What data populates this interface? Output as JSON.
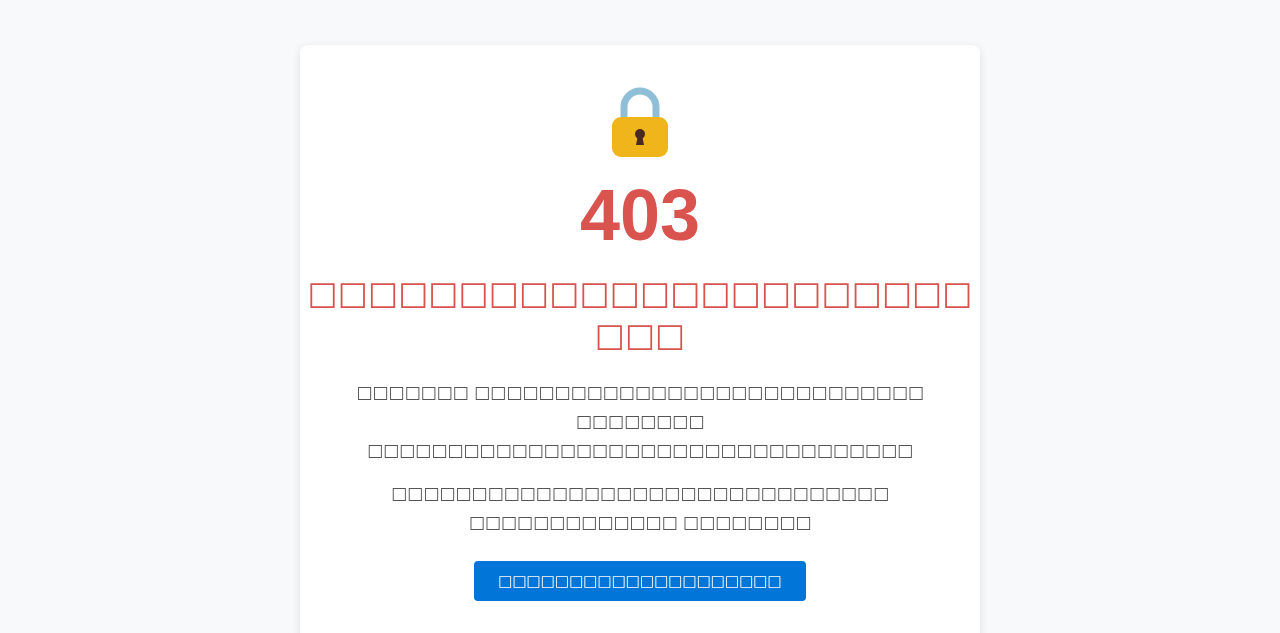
{
  "error": {
    "code": "403",
    "title": "□□□□□□□□□□□□□□□□□□□□□□ □□□",
    "paragraphs": [
      "□□□□□□□ □□□□□□□□□□□□□□□□□□□□□□□□□□□□ □□□□□□□□ □□□□□□□□□□□□□□□□□□□□□□□□□□□□□□□□□□",
      "□□□□□□□□□□□□□□□□□□□□□□□□□□□□□□□ □□□□□□□□□□□□□ □□□□□□□□"
    ],
    "button": "□□□□□□□□□□□□□□□□□□□□"
  }
}
